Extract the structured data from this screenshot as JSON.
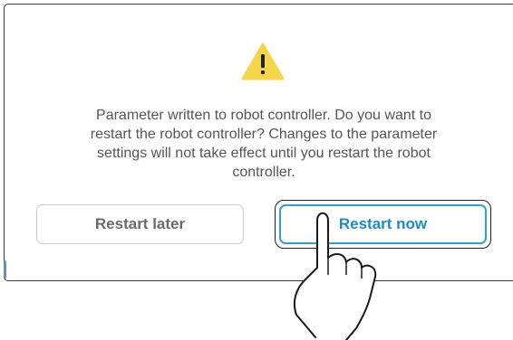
{
  "dialog": {
    "icon": "warning-triangle-icon",
    "message": "Parameter written to robot controller. Do you want to restart the robot controller? Changes to the parameter settings will not take effect until you restart the robot controller.",
    "buttons": {
      "restart_later": "Restart later",
      "restart_now": "Restart now"
    }
  },
  "overlay": {
    "icon": "tapping-hand-icon"
  },
  "colors": {
    "warning_fill": "#f5d64b",
    "primary_accent": "#2f9fd8",
    "secondary_border": "#c9c9c9",
    "message_text": "#555555"
  }
}
